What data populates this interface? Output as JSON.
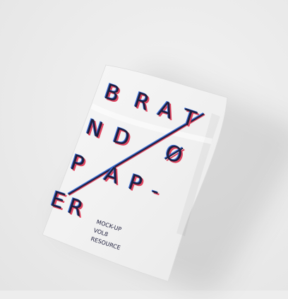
{
  "poster": {
    "rows": [
      [
        "B",
        "R",
        "A",
        "T"
      ],
      [
        "N",
        "D",
        "Ø"
      ],
      [
        "P",
        "A",
        "P",
        "-"
      ],
      [
        "E",
        "R"
      ]
    ],
    "tagline": [
      "MOCK-UP",
      "VOL8",
      "RESOURCE"
    ]
  },
  "colors": {
    "background": "#ededed",
    "paper": "#f4f4f4",
    "ink": "#1e1e3c",
    "shadow_red": "#e0455f",
    "shadow_blue": "#3a6fd8"
  }
}
